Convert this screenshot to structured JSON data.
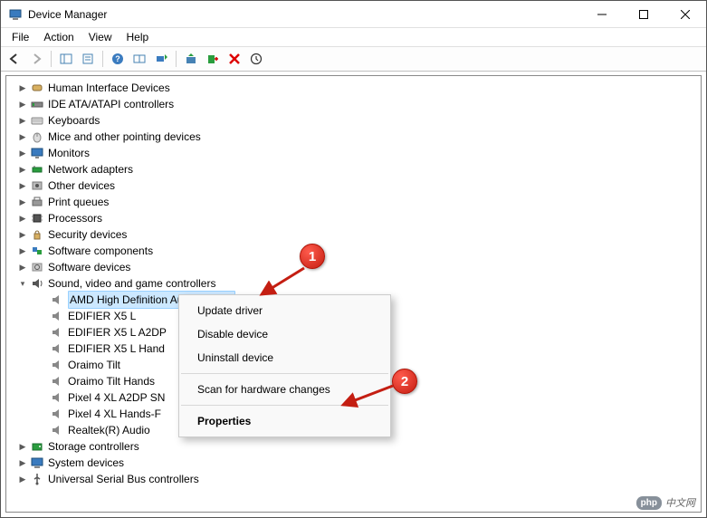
{
  "window": {
    "title": "Device Manager"
  },
  "menubar": {
    "file": "File",
    "action": "Action",
    "view": "View",
    "help": "Help"
  },
  "categories": {
    "hid": "Human Interface Devices",
    "ide": "IDE ATA/ATAPI controllers",
    "keyboards": "Keyboards",
    "mice": "Mice and other pointing devices",
    "monitors": "Monitors",
    "network": "Network adapters",
    "other": "Other devices",
    "print": "Print queues",
    "processors": "Processors",
    "security": "Security devices",
    "swcomp": "Software components",
    "swdev": "Software devices",
    "sound": "Sound, video and game controllers",
    "storage": "Storage controllers",
    "system": "System devices",
    "usb": "Universal Serial Bus controllers"
  },
  "sound_children": {
    "amd": "AMD High Definition Audio Device",
    "edifier_l": "EDIFIER X5 L",
    "edifier_a2dp": "EDIFIER X5 L A2DP",
    "edifier_hand": "EDIFIER X5 L Hand",
    "oraimo": "Oraimo Tilt",
    "oraimo_hands": "Oraimo Tilt Hands",
    "pixel_a2dp": "Pixel 4 XL A2DP SN",
    "pixel_hands": "Pixel 4 XL Hands-F",
    "realtek": "Realtek(R) Audio"
  },
  "context_menu": {
    "update": "Update driver",
    "disable": "Disable device",
    "uninstall": "Uninstall device",
    "scan": "Scan for hardware changes",
    "properties": "Properties"
  },
  "annotations": {
    "badge1": "1",
    "badge2": "2"
  },
  "watermark": {
    "php": "php",
    "cn": "中文网"
  }
}
